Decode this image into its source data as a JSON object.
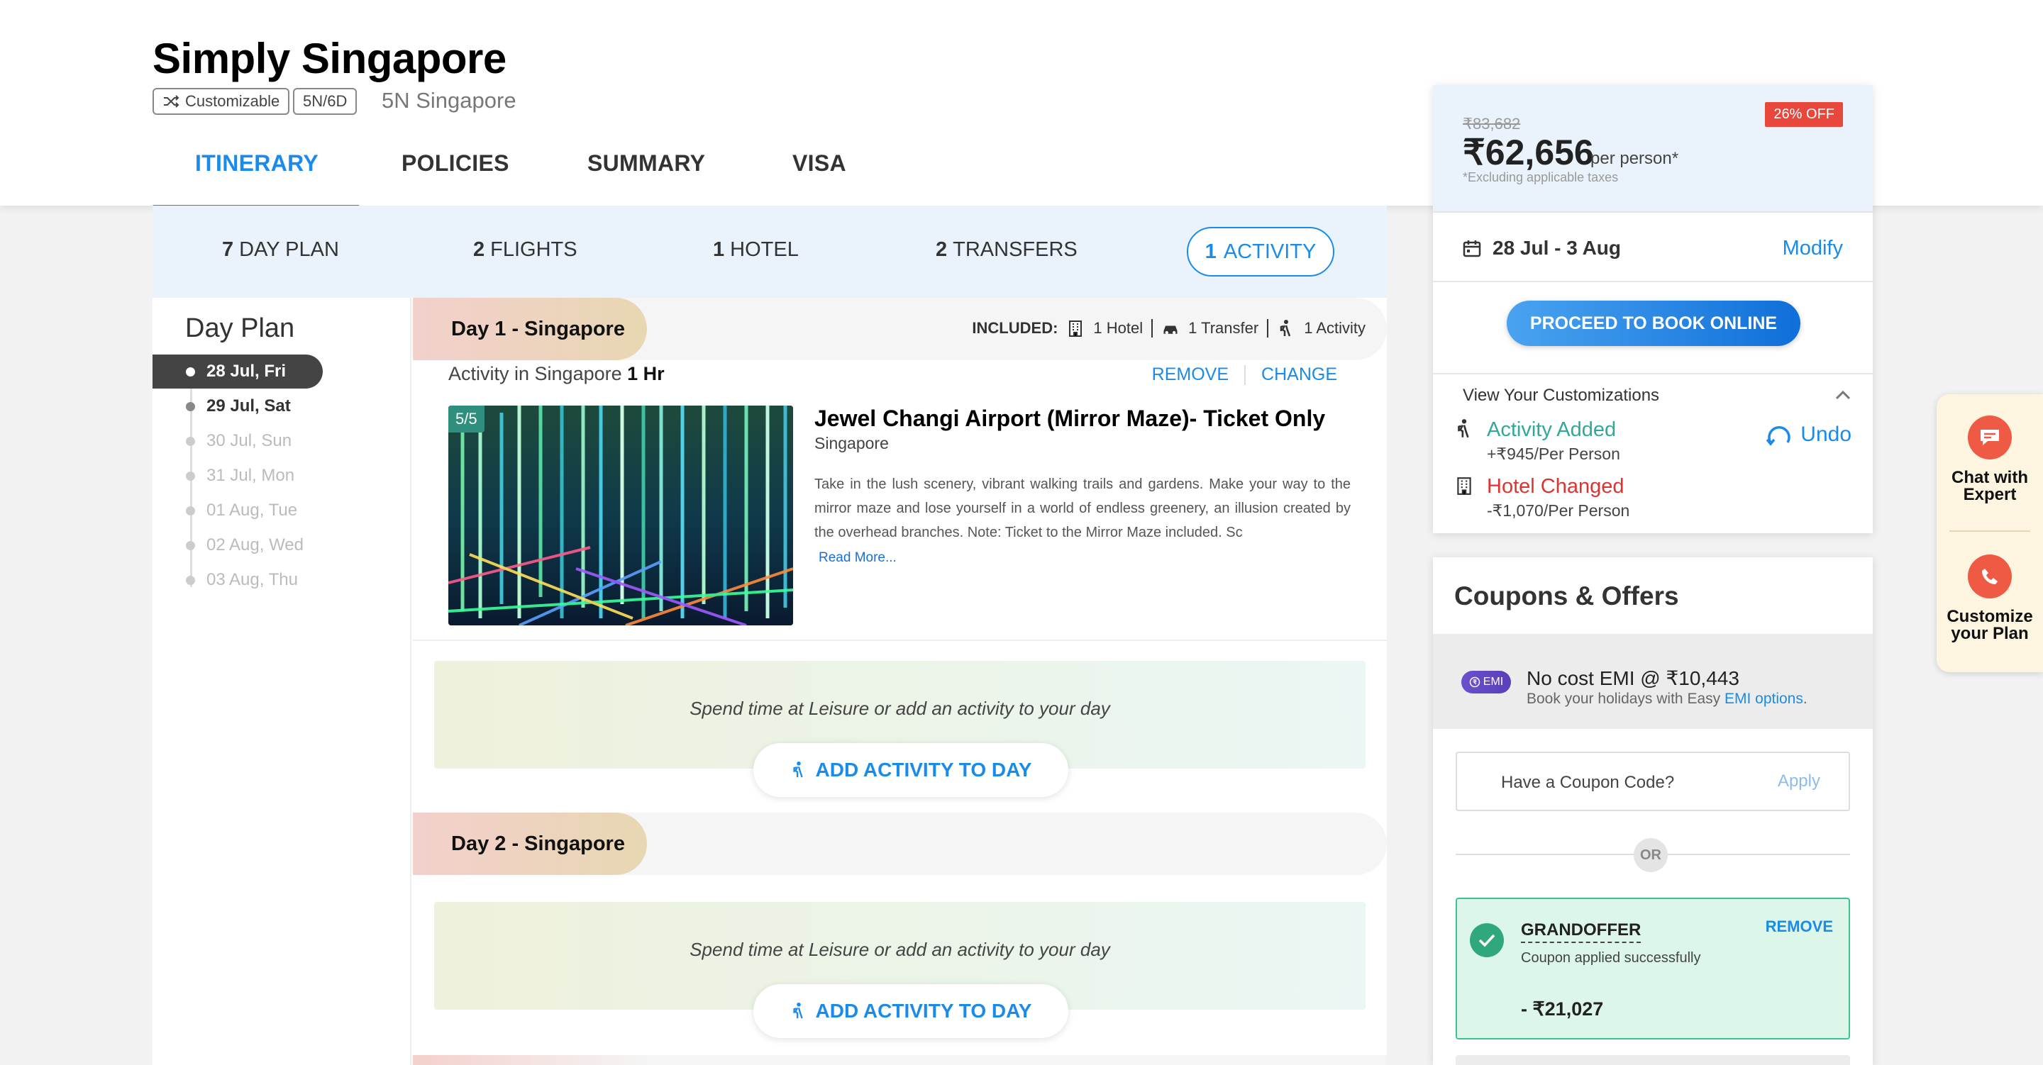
{
  "header": {
    "title": "Simply Singapore",
    "tag_customizable": "Customizable",
    "tag_duration": "5N/6D",
    "destination": "5N Singapore",
    "tabs": [
      {
        "label": "ITINERARY",
        "active": true
      },
      {
        "label": "POLICIES",
        "active": false
      },
      {
        "label": "SUMMARY",
        "active": false
      },
      {
        "label": "VISA",
        "active": false
      }
    ]
  },
  "summary_bar": [
    {
      "count": "7",
      "label": "DAY PLAN"
    },
    {
      "count": "2",
      "label": "FLIGHTS"
    },
    {
      "count": "1",
      "label": "HOTEL"
    },
    {
      "count": "2",
      "label": "TRANSFERS"
    },
    {
      "count": "1",
      "label": "ACTIVITY",
      "active": true
    }
  ],
  "day_plan": {
    "title": "Day Plan",
    "days": [
      "28 Jul, Fri",
      "29 Jul, Sat",
      "30 Jul, Sun",
      "31 Jul, Mon",
      "01 Aug, Tue",
      "02 Aug, Wed",
      "03 Aug, Thu"
    ]
  },
  "day1": {
    "label": "Day 1 - Singapore",
    "included_label": "INCLUDED:",
    "included": [
      "1 Hotel",
      "1 Transfer",
      "1 Activity"
    ],
    "activity_intro": "Activity in Singapore",
    "activity_duration": "1 Hr",
    "remove": "REMOVE",
    "change": "CHANGE",
    "image_badge": "5/5",
    "activity_name": "Jewel Changi Airport (Mirror Maze)- Ticket Only",
    "activity_location": "Singapore",
    "activity_desc": "Take in the lush scenery, vibrant walking trails and gardens. Make your way to the mirror maze and lose yourself in a world of endless greenery, an illusion created by the overhead branches. Note: Ticket to the Mirror Maze included. Sc",
    "read_more": "Read More...",
    "leisure_text": "Spend time at Leisure or add an activity to your day",
    "add_activity": "ADD ACTIVITY TO DAY"
  },
  "day2": {
    "label": "Day 2 - Singapore",
    "leisure_text": "Spend time at Leisure or add an activity to your day",
    "add_activity": "ADD ACTIVITY TO DAY"
  },
  "price": {
    "original": "₹83,682",
    "discount": "26% OFF",
    "current": "₹62,656",
    "per": "per person*",
    "excl": "*Excluding applicable taxes",
    "dates": "28 Jul - 3 Aug",
    "modify": "Modify",
    "proceed": "PROCEED TO BOOK ONLINE",
    "view_customizations": "View Your Customizations",
    "undo": "Undo",
    "customizations": [
      {
        "title": "Activity Added",
        "sub": "+₹945/Per Person",
        "color": "#2fa99a"
      },
      {
        "title": "Hotel Changed",
        "sub": "-₹1,070/Per Person",
        "color": "#e0332f"
      }
    ]
  },
  "coupons": {
    "title": "Coupons & Offers",
    "emi_badge": "EMI",
    "emi_title": "No cost EMI @ ₹10,443",
    "emi_sub_prefix": "Book your holidays with Easy ",
    "emi_sub_link": "EMI options",
    "emi_sub_suffix": ".",
    "coupon_placeholder": "Have a Coupon Code?",
    "apply": "Apply",
    "or": "OR",
    "applied_code": "GRANDOFFER",
    "applied_msg": "Coupon applied successfully",
    "applied_remove": "REMOVE",
    "applied_amount": "- ₹21,027"
  },
  "floating": {
    "chat": "Chat with Expert",
    "customize": "Customize your Plan"
  }
}
